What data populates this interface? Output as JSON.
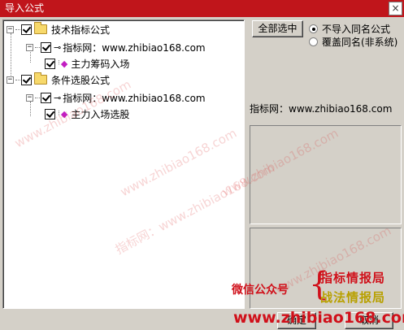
{
  "window": {
    "title": "导入公式",
    "close_glyph": "×"
  },
  "tree": {
    "group1": {
      "label": "技术指标公式",
      "expander": "−",
      "child": {
        "label": "指标网：www.zhibiao168.com",
        "expander": "−",
        "item": {
          "label": "主力筹码入场"
        }
      }
    },
    "group2": {
      "label": "条件选股公式",
      "expander": "−",
      "child": {
        "label": "指标网：www.zhibiao168.com",
        "expander": "−",
        "item": {
          "label": "主力入场选股"
        }
      }
    }
  },
  "buttons": {
    "select_all": "全部选中",
    "ok": "确定",
    "cancel": "取消"
  },
  "options": {
    "no_import": "不导入同名公式",
    "overwrite": "覆盖同名(非系统)",
    "selected": "no_import"
  },
  "info": {
    "label": "指标网：www.zhibiao168.com"
  },
  "promo": {
    "wechat": "微信公众号",
    "line1": "指标情报局",
    "line2": "战法情报局",
    "url": "www.zhibiao168.com"
  },
  "watermark": {
    "text": "指标网：www.zhibiao168.com",
    "short": "www.zhibiao168.com"
  },
  "colors": {
    "titlebar": "#c0151b",
    "promo_red": "#d0101a",
    "promo_gold": "#b8a000"
  }
}
